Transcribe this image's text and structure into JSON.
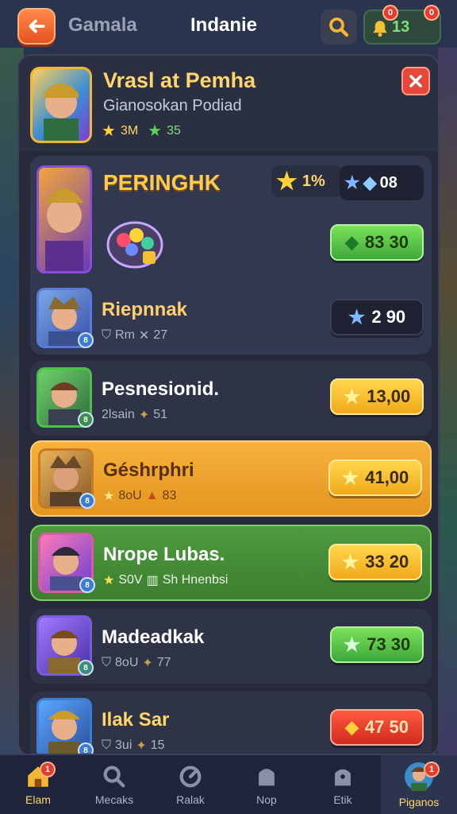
{
  "topbar": {
    "tab_left": "Gamala",
    "tab_center": "Indanie",
    "currency_value": "13",
    "notif_1": "0",
    "notif_2": "0"
  },
  "header": {
    "title": "Vrasl at Pemha",
    "subtitle": "Gianosokan Podiad",
    "stat_1": "3M",
    "stat_2": "35"
  },
  "featured": {
    "title": "PERINGHK",
    "star_pill": "1%",
    "gem_pill": "08",
    "price": "83 30",
    "sub_name": "Riepnnak",
    "sub_meta_1": "Rm",
    "sub_meta_2": "27",
    "sub_price": "2 90"
  },
  "rows": [
    {
      "name": "Pesnesionid.",
      "meta_1": "2lsain",
      "meta_2": "51",
      "price": "13,00"
    },
    {
      "name": "Géshrphri",
      "meta_1": "8oU",
      "meta_2": "83",
      "price": "41,00"
    },
    {
      "name": "Nrope Lubas.",
      "meta_1": "S0V",
      "meta_2": "Sh Hnenbsi",
      "price": "33 20"
    },
    {
      "name": "Madeadkak",
      "meta_1": "8oU",
      "meta_2": "77",
      "price": "73 30"
    },
    {
      "name": "Ilak Sar",
      "meta_1": "3ui",
      "meta_2": "15",
      "price": "47 50"
    }
  ],
  "nav": [
    {
      "label": "Elam",
      "icon": "home-icon",
      "badge": "1"
    },
    {
      "label": "Mecaks",
      "icon": "search-icon"
    },
    {
      "label": "Ralak",
      "icon": "gauge-icon"
    },
    {
      "label": "Nop",
      "icon": "shop-icon"
    },
    {
      "label": "Etik",
      "icon": "bag-icon"
    },
    {
      "label": "Piganos",
      "icon": "profile-icon",
      "badge": "1"
    }
  ],
  "colors": {
    "accent": "#ffd66b",
    "orange_row": "#f6b23c",
    "green_row": "#4f9a3e",
    "panel": "#262a3a"
  }
}
